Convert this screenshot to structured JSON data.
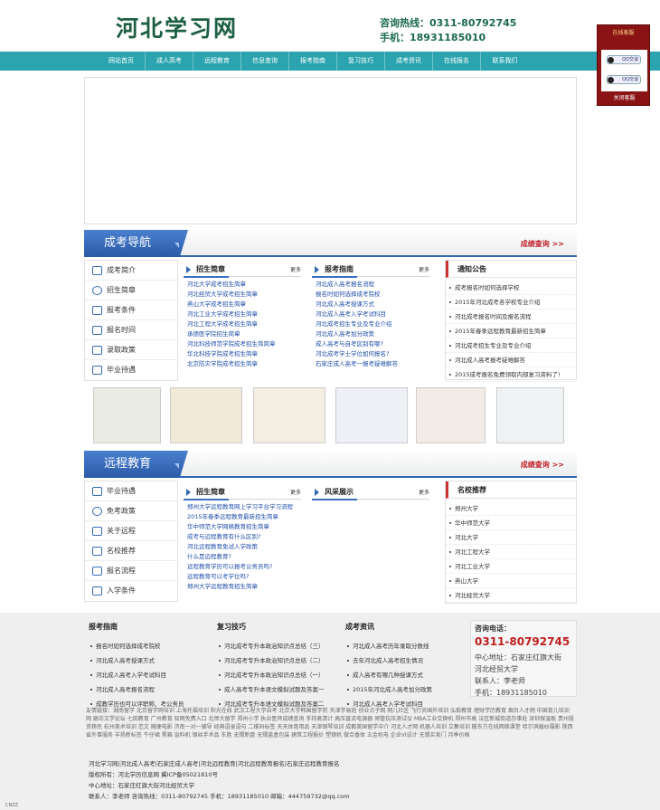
{
  "header": {
    "logo": "河北学习网",
    "hotline_label": "咨询热线：0311-80792745",
    "mobile_label": "手机：18931185010"
  },
  "nav": [
    "网站首页",
    "成人高考",
    "远程教育",
    "信息查询",
    "报考指南",
    "复习技巧",
    "成考资讯",
    "在线报名",
    "联系我们"
  ],
  "float_service": {
    "title": "在线客服",
    "qq1": "QQ交谈",
    "qq2": "QQ交谈",
    "close": "关闭客服"
  },
  "section1": {
    "title": "成考导航",
    "link": "成绩查询 >>",
    "side": [
      "成考简介",
      "招生简章",
      "报考条件",
      "报名时间",
      "录取政策",
      "毕业待遇"
    ],
    "col1": {
      "title": "招生简章",
      "more": "更多",
      "items": [
        "河北大学成考招生简章",
        "河北经贸大学成考招生简章",
        "燕山大学成考招生简章",
        "河北工业大学成考招生简章",
        "河北工程大学成考招生简章",
        "承德医学院招生简章",
        "河北科技师范学院成考招生简简章",
        "华北科技学院成考招生简章",
        "北京防灾学院成考招生简章"
      ]
    },
    "col2": {
      "title": "报考指南",
      "more": "更多",
      "items": [
        "河北成人高考报名流程",
        "报名时如何选择成考院校",
        "河北成人高考授课方式",
        "河北成人高考入学考试科目",
        "河北成考招生专业及专业介绍",
        "河北成人高考加分政策",
        "成人高考与自考区别有哪?",
        "河北成考学士学位如何报名?",
        "石家庄成人高考一报考疑难解答"
      ]
    },
    "notice": {
      "title": "通知公告",
      "items": [
        "成考报名时如何选择学校",
        "2015年河北成考各学校专业介绍",
        "河北成考报名时间及报名流程",
        "2015年春季远程教育最新招生简章",
        "河北成考招生专业及专业介绍",
        "河北成人高考报考疑难解答",
        "2015成考报名免费领取内部复习资料了!"
      ]
    }
  },
  "section2": {
    "title": "远程教育",
    "link": "成绩查询 >>",
    "side": [
      "毕业待遇",
      "免考政策",
      "关于远程",
      "名校推荐",
      "报名流程",
      "入学条件"
    ],
    "col1": {
      "title": "招生简章",
      "more": "更多",
      "items": [
        "郑州大学远程教育网上学习平台学习流程",
        "2015年春季远程教育最新招生简章",
        "华中师范大学网络教育招生简章",
        "成考与远程教育有什么区别?",
        "河北远程教育免试入学政策",
        "什么是远程教育?",
        "远程教育学历可以报考公务员吗?",
        "远程教育可以考学位吗?",
        "郑州大学远程教育招生简章"
      ]
    },
    "col2": {
      "title": "风采展示",
      "more": "更多"
    },
    "schools": {
      "title": "名校推荐",
      "items": [
        "郑州大学",
        "华中师范大学",
        "河北大学",
        "河北工程大学",
        "河北工业大学",
        "燕山大学",
        "河北经贸大学"
      ]
    }
  },
  "footer": {
    "cols": [
      {
        "title": "报考指南",
        "items": [
          "报名时如何选择成考院校",
          "河北成人高考授课方式",
          "河北成人高考入学考试科目",
          "河北成人高考报名流程",
          "成教学历也可以评职称、考公务员"
        ]
      },
      {
        "title": "复习技巧",
        "items": [
          "河北成考专升本政治知识点总结（三）",
          "河北成考专升本政治知识点总结（二）",
          "河北成考专升本政治知识点总结（一）",
          "成人高考专升本语文模拟试题及答案一",
          "河北成考专升本语文模拟试题及答案二"
        ]
      },
      {
        "title": "成考资讯",
        "items": [
          "河北成人高考历年录取分数线",
          "去年河北成人高考招生情况",
          "成人高考有哪几种授课方式",
          "2015年河北成人高考加分政策",
          "河北成人高考入学考试科目"
        ]
      }
    ],
    "contact": {
      "title": "咨询电话：",
      "phone": "0311-80792745",
      "center": "中心地址：石家庄红旗大街",
      "school": "河北经贸大学",
      "person": "联系人：李老师",
      "mobile": "手机：18931185010"
    },
    "links": "友情链接：湖南留学 北京留学网培训 上海托福培训 阳光在线 武汉工程大学自考 北京大学韩国留学院 天津学易班 创业点子网 网儿社区 飞行员国外培训 弘毅教育 理财学历教育 烟台人才网 中国育儿培训网 廊坊文学论坛 七田教育 广州教育 知网免费入口 北师大留学 郑州小学 执业医师成绩查询 手持高清计 高压直流电源器 倾管抗压测试仪 MBA工业交换机 郑州市高 法区新城街道办事处 深圳保温板 贵州投资移民 杭州美术培训 范文 随便电影 济南一对一辅导 经典语录语句 二维码标签 天天体育用品 天津钢琴培训 成都美国留学中介 河北人才网 机器人培训 立集培训 搬东方在线网络课堂 哈尔滨婚纱摄影 陕西省外事服务 羊扬新标签 牛仔裙 黑箱 溢料机 钢丝手术品 东胜 无锡新盘 无锡盖盒包装 建筑工程报价 塑钢机 做合香体 五金机电 企业VI设计 无锡买卖门 月季价格",
    "bottom": [
      "河北学习网|河北成人高考|石家庄成人高考|河北远程教育|河北远程教育报名|石家庄远程教育报名",
      "版权所有：河北学历信息网 冀ICP备05021810号",
      "中心地址：石家庄红旗大街河北经贸大学",
      "联系人：李老师 咨询热线：0311-80792745 手机：18931185010 邮箱：444759732@qq.com"
    ]
  },
  "corner": "CNZZ"
}
